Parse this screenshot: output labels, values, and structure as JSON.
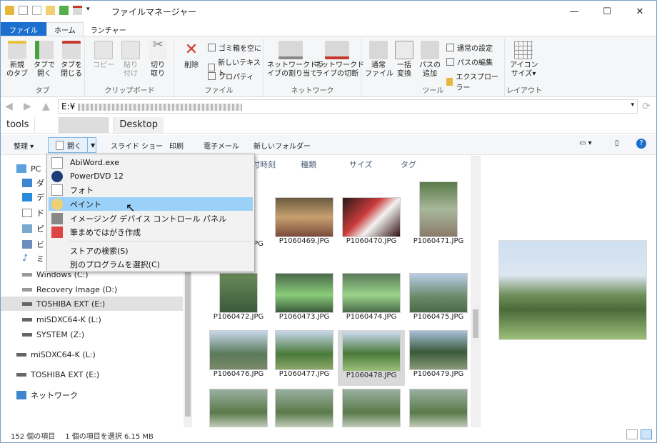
{
  "window": {
    "title": "ファイルマネージャー"
  },
  "title_buttons": {
    "minimize": "—",
    "maximize": "☐",
    "close": "✕"
  },
  "ribbon_tabs": [
    "ファイル",
    "ホーム",
    "ランチャー"
  ],
  "ribbon": {
    "new_tab": "新規\nのタブ",
    "open_tab": "タブで\n開く",
    "close_tab": "タブを\n閉じる",
    "tab_group": "タブ",
    "copy": "コピー",
    "paste": "貼り\n付け",
    "cut": "切り\n取り",
    "clipboard_group": "クリップボード",
    "delete": "削除",
    "empty_trash": "ゴミ箱を空に",
    "new_text": "新しいテキスト",
    "properties": "プロパティ",
    "file_group": "ファイル",
    "map_drive": "ネットワークドラ\nイブの割り当て",
    "disconnect": "ネットワークド\nライブの切断",
    "network_group": "ネットワーク",
    "normal_file": "通常\nファイル",
    "bulk_convert": "一括\n変換",
    "add_path": "パスの\n追加",
    "normal_settings": "通常の設定",
    "edit_path": "パスの編集",
    "explorer": "エクスプローラー",
    "tools_group": "ツール",
    "icon_size": "アイコン\nサイズ▾",
    "layout_group": "レイアウト"
  },
  "address": {
    "path": "E:¥"
  },
  "breadcrumbs": [
    "tools",
    "Desktop"
  ],
  "commands": {
    "organize": "整理 ▾",
    "open": "開く",
    "slideshow": "スライド ショー",
    "print": "印刷",
    "email": "電子メール",
    "new_folder": "新しいフォルダー"
  },
  "nav": {
    "items": [
      "PC",
      "ダ",
      "デ",
      "ド",
      "ピ",
      "ビ",
      "ミ",
      "Windows (C:)",
      "Recovery Image (D:)",
      "TOSHIBA EXT (E:)",
      "miSDXC64-K (L:)",
      "SYSTEM (Z:)",
      "miSDXC64-K (L:)",
      "TOSHIBA EXT (E:)",
      "ネットワーク"
    ]
  },
  "columns": [
    "付時刻",
    "種類",
    "サイズ",
    "タグ"
  ],
  "files": [
    {
      "name": "PG"
    },
    {
      "name": "P1060469.JPG"
    },
    {
      "name": "P1060470.JPG"
    },
    {
      "name": "P1060471.JPG"
    },
    {
      "name": "P1060472.JPG"
    },
    {
      "name": "P1060473.JPG"
    },
    {
      "name": "P1060474.JPG"
    },
    {
      "name": "P1060475.JPG"
    },
    {
      "name": "P1060476.JPG"
    },
    {
      "name": "P1060477.JPG"
    },
    {
      "name": "P1060478.JPG"
    },
    {
      "name": "P1060479.JPG"
    }
  ],
  "menu": {
    "items": [
      "AbiWord.exe",
      "PowerDVD 12",
      "フォト",
      "ペイント",
      "イメージング デバイス コントロール パネル",
      "筆まめではがき作成"
    ],
    "store": "ストアの検索(S)",
    "choose": "別のプログラムを選択(C)"
  },
  "status": {
    "count": "152 個の項目",
    "selection": "1 個の項目を選択  6.15 MB"
  },
  "colors": {
    "accent": "#1a6fcf",
    "highlight": "#9bd1f8"
  }
}
